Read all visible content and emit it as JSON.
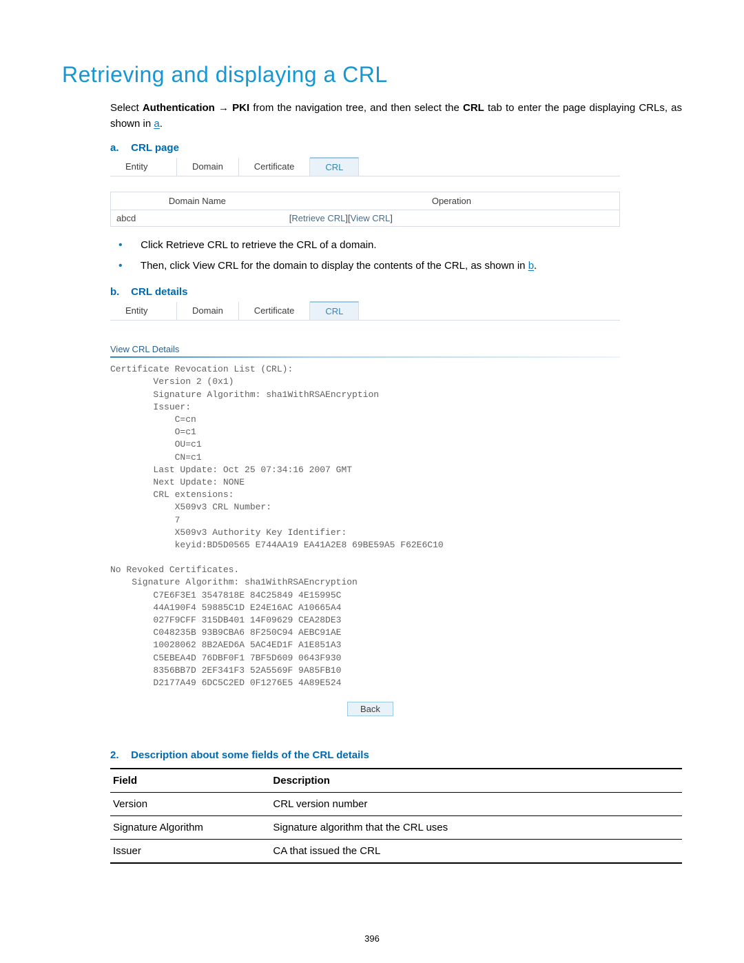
{
  "title": "Retrieving and displaying a CRL",
  "intro": {
    "prefix": "Select ",
    "nav1": "Authentication",
    "nav2": "PKI",
    "mid": " from the navigation tree, and then select the ",
    "tab": "CRL",
    "suffix": " tab to enter the page displaying CRLs, as shown in ",
    "link": "a",
    "end": "."
  },
  "section_a": {
    "label": "a.",
    "title": "CRL page"
  },
  "tabs": [
    "Entity",
    "Domain",
    "Certificate",
    "CRL"
  ],
  "table": {
    "headers": [
      "Domain Name",
      "Operation"
    ],
    "row": {
      "name": "abcd",
      "op1": "Retrieve CRL",
      "op2": "View CRL"
    }
  },
  "bullets": {
    "b1": {
      "prefix": "Click ",
      "bold": "Retrieve CRL",
      "suffix": " to retrieve the CRL of a domain."
    },
    "b2": {
      "prefix": "Then, click ",
      "bold": "View CRL",
      "suffix": " for the domain to display the contents of the CRL, as shown in ",
      "link": "b",
      "end": "."
    }
  },
  "section_b": {
    "label": "b.",
    "title": "CRL details"
  },
  "view_crl_header": "View CRL Details",
  "crl_text": "Certificate Revocation List (CRL):\n        Version 2 (0x1)\n        Signature Algorithm: sha1WithRSAEncryption\n        Issuer:\n            C=cn\n            O=c1\n            OU=c1\n            CN=c1\n        Last Update: Oct 25 07:34:16 2007 GMT\n        Next Update: NONE\n        CRL extensions:\n            X509v3 CRL Number:\n            7\n            X509v3 Authority Key Identifier:\n            keyid:BD5D0565 E744AA19 EA41A2E8 69BE59A5 F62E6C10\n\nNo Revoked Certificates.\n    Signature Algorithm: sha1WithRSAEncryption\n        C7E6F3E1 3547818E 84C25849 4E15995C\n        44A190F4 59885C1D E24E16AC A10665A4\n        027F9CFF 315DB401 14F09629 CEA28DE3\n        C048235B 93B9CBA6 8F250C94 AEBC91AE\n        10028062 8B2AED6A 5AC4ED1F A1E851A3\n        C5EBEA4D 76DBF0F1 7BF5D609 0643F930\n        8356BB7D 2EF341F3 52A5569F 9A85FB10\n        D2177A49 6DC5C2ED 0F1276E5 4A89E524",
  "back_label": "Back",
  "section_2": {
    "label": "2.",
    "title": "Description about some fields of the CRL details"
  },
  "desc_headers": {
    "field": "Field",
    "desc": "Description"
  },
  "desc_rows": [
    {
      "field": "Version",
      "desc": "CRL version number"
    },
    {
      "field": "Signature Algorithm",
      "desc": "Signature algorithm that the CRL uses"
    },
    {
      "field": "Issuer",
      "desc": "CA that issued the CRL"
    }
  ],
  "page_number": "396"
}
